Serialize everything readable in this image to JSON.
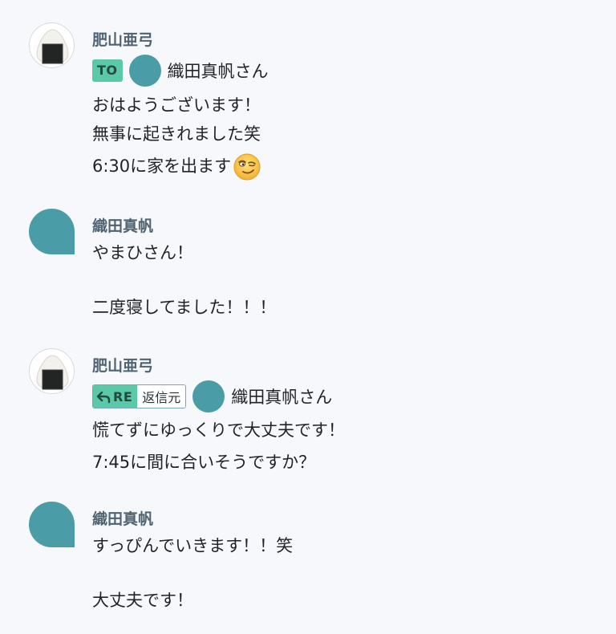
{
  "messages": [
    {
      "sender": "肥山亜弓",
      "to": {
        "badge": "TO",
        "name": "織田真帆さん"
      },
      "lines": [
        "おはようございます！",
        "無事に起きれました笑",
        "6:30に家を出ます"
      ],
      "emoji": "smirking-face"
    },
    {
      "sender": "織田真帆",
      "lines": [
        "やまひさん！",
        "二度寝してました！！！"
      ]
    },
    {
      "sender": "肥山亜弓",
      "reply": {
        "badge": "RE",
        "source_label": "返信元",
        "name": "織田真帆さん"
      },
      "lines": [
        "慌てずにゆっくりで大丈夫です！",
        "7:45に間に合いそうですか？"
      ]
    },
    {
      "sender": "織田真帆",
      "lines": [
        "すっぴんでいきます！！笑",
        "大丈夫です！"
      ]
    }
  ],
  "colors": {
    "background": "#f6f8fb",
    "sender_name": "#4f6372",
    "badge_green": "#5bc8a8",
    "avatar_teal": "#4a9ca6"
  }
}
